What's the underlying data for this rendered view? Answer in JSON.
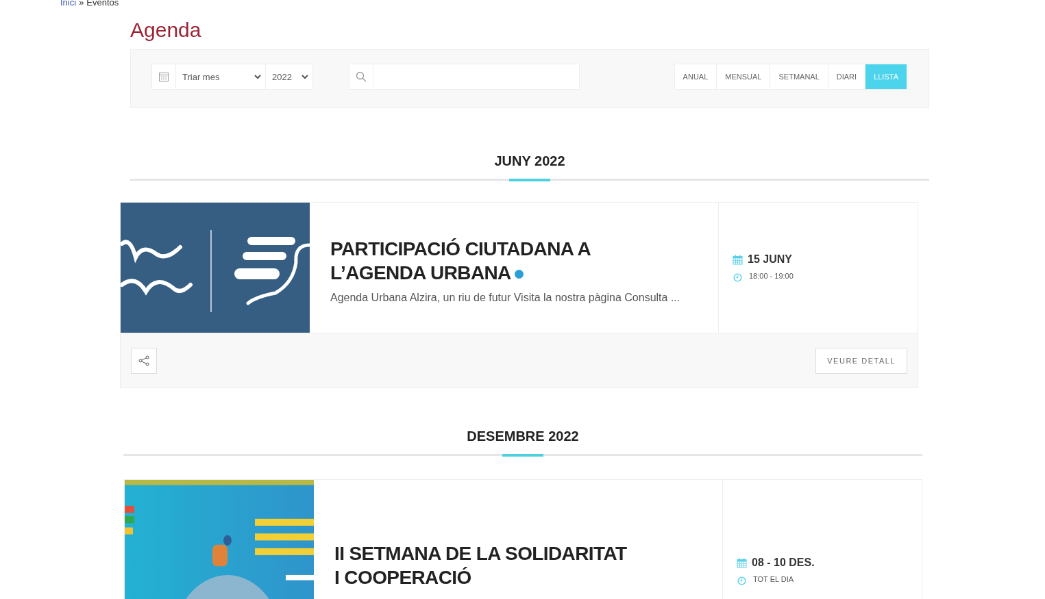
{
  "breadcrumb": {
    "link": "Inici",
    "separator": "»",
    "current": "Eventos"
  },
  "title": "Agenda",
  "filters": {
    "month": {
      "value": "Triar mes"
    },
    "year": {
      "value": "2022"
    }
  },
  "views": [
    {
      "label": "ANUAL",
      "selected": false
    },
    {
      "label": "MENSUAL",
      "selected": false
    },
    {
      "label": "SETMANAL",
      "selected": false
    },
    {
      "label": "DIARI",
      "selected": false
    },
    {
      "label": "LLISTA",
      "selected": true
    }
  ],
  "months": [
    {
      "heading": "JUNY 2022",
      "events": [
        {
          "kind": "picture",
          "title": "PARTICIPACIÓ CIUTADANA A L’AGENDA URBANA",
          "color": "#2a9fd6",
          "excerpt": "Agenda Urbana Alzira, un riu de futur Visita la nostra pàgina Consulta ...",
          "date": "15 JUNY",
          "time": "18:00 - 19:00",
          "button": "VEURE DETALL"
        }
      ]
    },
    {
      "heading": "DESEMBRE 2022",
      "events": [
        {
          "kind": "picture",
          "title": "II SETMANA DE LA SOLIDARITAT I COOPERACIÓ",
          "date": "08 - 10 DES.",
          "time": "TOT EL DIA"
        }
      ]
    }
  ]
}
